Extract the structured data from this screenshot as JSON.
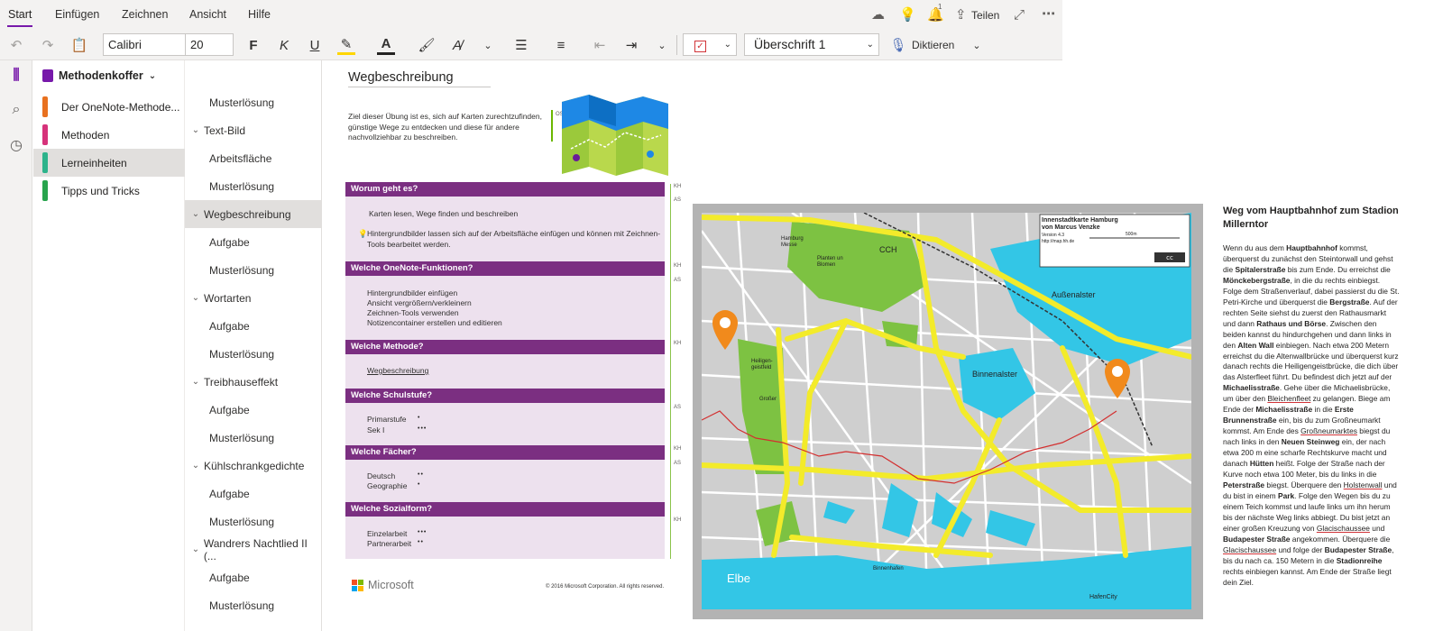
{
  "ribbon": {
    "tabs": [
      "Start",
      "Einfügen",
      "Zeichnen",
      "Ansicht",
      "Hilfe"
    ],
    "notification_count": "1",
    "share_label": "Teilen",
    "font_name": "Calibri",
    "font_size": "20",
    "bold_label": "F",
    "italic_label": "K",
    "underline_label": "U",
    "style_value": "Überschrift 1",
    "dictate_label": "Diktieren"
  },
  "notebook": {
    "name": "Methodenkoffer",
    "sections": [
      {
        "label": "Der OneNote-Methode...",
        "color": "#e8711f"
      },
      {
        "label": "Methoden",
        "color": "#d6327a"
      },
      {
        "label": "Lerneinheiten",
        "color": "#2db38b"
      },
      {
        "label": "Tipps und Tricks",
        "color": "#28a44d"
      }
    ]
  },
  "pages": [
    {
      "label": "Musterlösung",
      "level": 1
    },
    {
      "label": "Text-Bild",
      "level": 0
    },
    {
      "label": "Arbeitsfläche",
      "level": 1
    },
    {
      "label": "Musterlösung",
      "level": 1
    },
    {
      "label": "Wegbeschreibung",
      "level": 0
    },
    {
      "label": "Aufgabe",
      "level": 1
    },
    {
      "label": "Musterlösung",
      "level": 1
    },
    {
      "label": "Wortarten",
      "level": 0
    },
    {
      "label": "Aufgabe",
      "level": 1
    },
    {
      "label": "Musterlösung",
      "level": 1
    },
    {
      "label": "Treibhauseffekt",
      "level": 0
    },
    {
      "label": "Aufgabe",
      "level": 1
    },
    {
      "label": "Musterlösung",
      "level": 1
    },
    {
      "label": "Kühlschrankgedichte",
      "level": 0
    },
    {
      "label": "Aufgabe",
      "level": 1
    },
    {
      "label": "Musterlösung",
      "level": 1
    },
    {
      "label": "Wandrers Nachtlied II (...",
      "level": 0
    },
    {
      "label": "Aufgabe",
      "level": 1
    },
    {
      "label": "Musterlösung",
      "level": 1
    }
  ],
  "page": {
    "title": "Wegbeschreibung",
    "intro": "Ziel dieser Übung ist es, sich auf Karten zurechtzufinden, günstige Wege zu entdecken und diese für andere nachvollziehbar zu beschreiben.",
    "os_tag": "OS",
    "card": {
      "h1": "Worum geht es?",
      "t1a": "Karten lesen, Wege finden und beschreiben",
      "t1b": "Hintergrundbilder lassen sich auf der Arbeitsfläche einfügen und können mit Zeichnen-Tools bearbeitet werden.",
      "h2": "Welche OneNote-Funktionen?",
      "t2": [
        "Hintergrundbilder einfügen",
        "Ansicht vergrößern/verkleinern",
        "Zeichnen-Tools verwenden",
        "Notizencontainer erstellen und editieren"
      ],
      "h3": "Welche Methode?",
      "t3": "Wegbeschreibung",
      "h4": "Welche Schulstufe?",
      "t4a": "Primarstufe",
      "t4a_dots": "•",
      "t4b": "Sek I",
      "t4b_dots": "•••",
      "h5": "Welche Fächer?",
      "t5a": "Deutsch",
      "t5a_dots": "••",
      "t5b": "Geographie",
      "t5b_dots": "•",
      "h6": "Welche Sozialform?",
      "t6a": "Einzelarbeit",
      "t6a_dots": "•••",
      "t6b": "Partnerarbeit",
      "t6b_dots": "••"
    },
    "side_tags": [
      "KH",
      "AS",
      "KH",
      "AS",
      "KH",
      "AS",
      "KH",
      "AS",
      "KH"
    ],
    "ms_logo": "Microsoft",
    "copyright": "© 2016 Microsoft Corporation. All rights reserved.",
    "map": {
      "title": "Innenstadtkarte Hamburg",
      "author": "von Marcus Venzke",
      "version": "Version 4.3",
      "scale": "500m",
      "url": "http://map.hh.de",
      "labels": {
        "ccm": "CCH",
        "aussenalster": "Außenalster",
        "binnenalster": "Binnenalster",
        "elbe": "Elbe",
        "hafencity": "HafenCity",
        "heiligengeistfeld": "Heiligen-geistfeld",
        "hamburg_messe": "Hamburg Messe",
        "gross": "Großer",
        "planten": "Planten un Blomen",
        "binnenhafen": "Binnenhafen"
      }
    },
    "side_title": "Weg vom Hauptbahnhof zum Stadion Millerntor",
    "side_text": "Wenn du aus dem Hauptbahnhof kommst, überquerst du zunächst den Steintorwall und gehst die Spitalerstraße bis zum Ende. Du erreichst die Mönckebergstraße, in die du rechts einbiegst. Folge dem Straßenverlauf, dabei passierst du die St. Petri-Kirche und überquerst die Bergstraße. Auf der rechten Seite siehst du zuerst den Rathausmarkt und dann Rathaus und Börse. Zwischen den beiden kannst du hindurchgehen und dann links in den Alten Wall einbiegen. Nach etwa 200 Metern erreichst du die Altenwallbrücke und überquerst kurz danach rechts die Heiligengeistbrücke, die dich über das Alsterfleet führt. Du befindest dich jetzt auf der Michaelisstraße. Gehe über die Michaelisbrücke, um über den Bleichenfleet zu gelangen. Biege am Ende der Michaelisstraße in die Erste Brunnenstraße ein, bis du zum Großneumarkt kommst. Am Ende des Großneumarktes biegst du nach links in den Neuen Steinweg ein, der nach etwa 200 m eine scharfe Rechtskurve macht und danach Hütten heißt. Folge der Straße nach der Kurve noch etwa 100 Meter, bis du links in die Peterstraße biegst. Überquere den Holstenwall und du bist in einem Park. Folge den Wegen bis du zu einem Teich kommst und laufe links um ihn herum bis der nächste Weg links abbiegt. Du bist jetzt an einer großen Kreuzung von Glacischaussee und Budapester Straße angekommen. Überquere die Glacischaussee und folge der Budapester Straße, bis du nach ca. 150 Metern in die Stadionreihe rechts einbiegen kannst. Am Ende der Straße liegt dein Ziel."
  }
}
